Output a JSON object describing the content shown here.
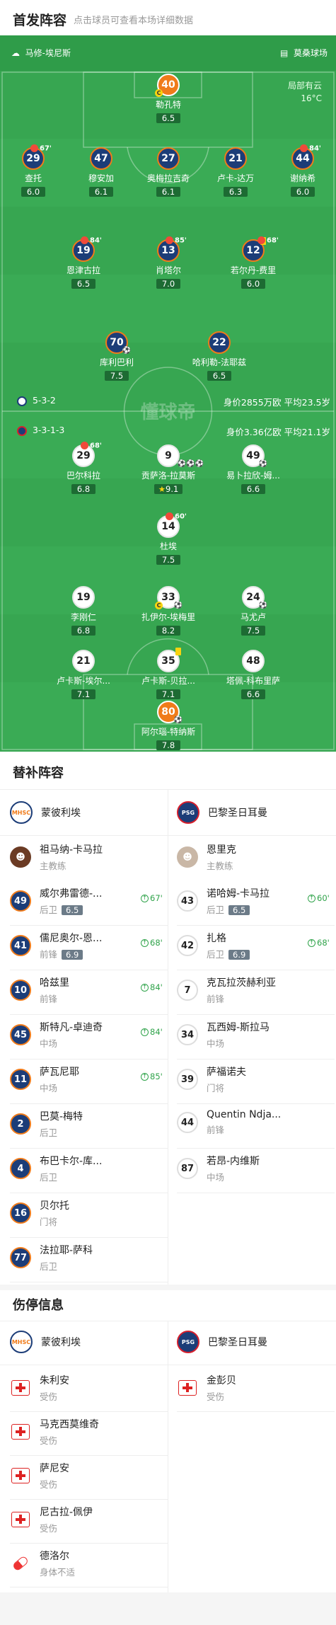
{
  "header": {
    "title": "首发阵容",
    "subtitle": "点击球员可查看本场详细数据"
  },
  "pitch": {
    "home_team": "马修-埃尼斯",
    "away_team": "莫桑球场",
    "weather": "局部有云",
    "temp": "16°C",
    "home_formation": "5-3-2",
    "home_info": "身价2855万欧 平均23.5岁",
    "away_formation": "3-3-1-3",
    "away_info": "身价3.36亿欧 平均21.1岁",
    "watermark": "懂球帝",
    "home": [
      {
        "num": "40",
        "name": "勒孔特",
        "rating": "6.5"
      },
      {
        "num": "29",
        "name": "查托",
        "rating": "6.0",
        "sub": "67'"
      },
      {
        "num": "47",
        "name": "穆安加",
        "rating": "6.1"
      },
      {
        "num": "27",
        "name": "奥梅拉吉奇",
        "rating": "6.1"
      },
      {
        "num": "21",
        "name": "卢卡-达万",
        "rating": "6.3"
      },
      {
        "num": "44",
        "name": "谢纳希",
        "rating": "6.0",
        "sub": "84'"
      },
      {
        "num": "19",
        "name": "恩津古拉",
        "rating": "6.5",
        "sub": "84'"
      },
      {
        "num": "13",
        "name": "肖塔尔",
        "rating": "7.0",
        "sub": "85'"
      },
      {
        "num": "12",
        "name": "若尔丹-费里",
        "rating": "6.0",
        "sub": "68'"
      },
      {
        "num": "70",
        "name": "库利巴利",
        "rating": "7.5"
      },
      {
        "num": "22",
        "name": "哈利勒-法耶兹",
        "rating": "6.5"
      }
    ],
    "away": [
      {
        "num": "29",
        "name": "巴尔科拉",
        "rating": "6.8",
        "sub": "68'"
      },
      {
        "num": "9",
        "name": "贡萨洛-拉莫斯",
        "rating": "9.1"
      },
      {
        "num": "49",
        "name": "易卜拉欣-姆...",
        "rating": "6.6"
      },
      {
        "num": "14",
        "name": "杜埃",
        "rating": "7.5",
        "sub": "60'"
      },
      {
        "num": "19",
        "name": "李刚仁",
        "rating": "6.8"
      },
      {
        "num": "33",
        "name": "扎伊尔-埃梅里",
        "rating": "8.2"
      },
      {
        "num": "24",
        "name": "马尤卢",
        "rating": "7.5"
      },
      {
        "num": "21",
        "name": "卢卡斯-埃尔...",
        "rating": "7.1"
      },
      {
        "num": "35",
        "name": "卢卡斯-贝拉...",
        "rating": "7.1"
      },
      {
        "num": "48",
        "name": "塔佩-科布里萨",
        "rating": "6.6"
      },
      {
        "num": "80",
        "name": "阿尔瑙-特纳斯",
        "rating": "7.8"
      }
    ]
  },
  "subs": {
    "title": "替补阵容",
    "home_name": "蒙彼利埃",
    "away_name": "巴黎圣日耳曼",
    "home_coach": {
      "name": "祖马纳-卡马拉",
      "pos": "主教练"
    },
    "away_coach": {
      "name": "恩里克",
      "pos": "主教练"
    },
    "home": [
      {
        "num": "49",
        "name": "威尔弗雷德-...",
        "pos": "后卫",
        "rating": "6.5",
        "sub": "67'"
      },
      {
        "num": "41",
        "name": "儒尼奥尔-恩...",
        "pos": "前锋",
        "rating": "6.9",
        "sub": "68'"
      },
      {
        "num": "10",
        "name": "哈兹里",
        "pos": "前锋",
        "sub": "84'"
      },
      {
        "num": "45",
        "name": "斯特凡-卓迪奇",
        "pos": "中场",
        "sub": "84'"
      },
      {
        "num": "11",
        "name": "萨瓦尼耶",
        "pos": "中场",
        "sub": "85'"
      },
      {
        "num": "2",
        "name": "巴莫-梅特",
        "pos": "后卫"
      },
      {
        "num": "4",
        "name": "布巴卡尔-库...",
        "pos": "后卫"
      },
      {
        "num": "16",
        "name": "贝尔托",
        "pos": "门将"
      },
      {
        "num": "77",
        "name": "法拉耶-萨科",
        "pos": "后卫"
      }
    ],
    "away": [
      {
        "num": "43",
        "name": "诺哈姆-卡马拉",
        "pos": "后卫",
        "rating": "6.5",
        "sub": "60'"
      },
      {
        "num": "42",
        "name": "扎格",
        "pos": "后卫",
        "rating": "6.9",
        "sub": "68'"
      },
      {
        "num": "7",
        "name": "克瓦拉茨赫利亚",
        "pos": "前锋"
      },
      {
        "num": "34",
        "name": "瓦西姆-斯拉马",
        "pos": "中场"
      },
      {
        "num": "39",
        "name": "萨福诺夫",
        "pos": "门将"
      },
      {
        "num": "44",
        "name": "Quentin Ndja...",
        "pos": "前锋"
      },
      {
        "num": "87",
        "name": "若昂-内维斯",
        "pos": "中场"
      }
    ]
  },
  "injuries": {
    "title": "伤停信息",
    "home_name": "蒙彼利埃",
    "away_name": "巴黎圣日耳曼",
    "home": [
      {
        "name": "朱利安",
        "status": "受伤"
      },
      {
        "name": "马克西莫维奇",
        "status": "受伤"
      },
      {
        "name": "萨尼安",
        "status": "受伤"
      },
      {
        "name": "尼古拉-佩伊",
        "status": "受伤"
      },
      {
        "name": "德洛尔",
        "status": "身体不适"
      }
    ],
    "away": [
      {
        "name": "金彭贝",
        "status": "受伤"
      }
    ]
  }
}
